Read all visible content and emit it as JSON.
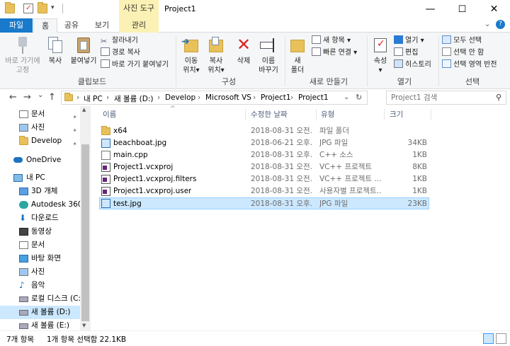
{
  "window": {
    "title": "Project1",
    "context_tab_title": "사진 도구",
    "minimize": "—",
    "maximize": "☐",
    "close": "✕"
  },
  "ribbon_tabs": {
    "file": "파일",
    "home": "홈",
    "share": "공유",
    "view": "보기",
    "manage": "관리"
  },
  "clipboard": {
    "pin_quick": "바로 가기에 고정",
    "pin_l1": "바로 가기에",
    "pin_l2": "고정",
    "copy": "복사",
    "paste": "붙여넣기",
    "cut": "잘라내기",
    "copy_path": "경로 복사",
    "paste_shortcut": "바로 가기 붙여넣기",
    "label": "클립보드"
  },
  "organize": {
    "move_l1": "이동",
    "move_l2": "위치▾",
    "copy_l1": "복사",
    "copy_l2": "위치▾",
    "delete": "삭제",
    "rename_l1": "이름",
    "rename_l2": "바꾸기",
    "label": "구성"
  },
  "new_group": {
    "folder_l1": "새",
    "folder_l2": "폴더",
    "new_item": "새 항목 ▾",
    "easy_access": "빠른 연결 ▾",
    "label": "새로 만들기"
  },
  "open_group": {
    "properties": "속성",
    "open": "열기 ▾",
    "edit": "편집",
    "history": "히스토리",
    "label": "열기"
  },
  "select_group": {
    "select_all": "모두 선택",
    "select_none": "선택 안 함",
    "invert": "선택 영역 반전",
    "label": "선택"
  },
  "address": {
    "back": "←",
    "forward": "→",
    "recent": "⌄",
    "up": "↑",
    "crumbs": [
      "내 PC",
      "새 볼륨 (D:)",
      "Develop",
      "Microsoft VS",
      "Project1",
      "Project1"
    ],
    "sep": "›",
    "refresh": "↻",
    "search_placeholder": "Project1 검색"
  },
  "navpane": {
    "items": [
      {
        "label": "문서",
        "pinned": true
      },
      {
        "label": "사진",
        "pinned": true
      },
      {
        "label": "Develop",
        "pinned": true
      },
      {
        "label": "OneDrive"
      },
      {
        "label": "내 PC"
      },
      {
        "label": "3D 개체"
      },
      {
        "label": "Autodesk 360"
      },
      {
        "label": "다운로드"
      },
      {
        "label": "동영상"
      },
      {
        "label": "문서"
      },
      {
        "label": "바탕 화면"
      },
      {
        "label": "사진"
      },
      {
        "label": "음악"
      },
      {
        "label": "로컬 디스크 (C:)"
      },
      {
        "label": "새 볼륨 (D:)"
      },
      {
        "label": "새 볼륨 (E:)"
      }
    ],
    "pin_glyph": "📌"
  },
  "columns": {
    "name": "이름",
    "date": "수정한 날짜",
    "type": "유형",
    "size": "크기",
    "sort_glyph": "^"
  },
  "files": [
    {
      "name": "x64",
      "date": "2018-08-31 오전...",
      "type": "파일 폴더",
      "size": "",
      "kind": "folder"
    },
    {
      "name": "beachboat.jpg",
      "date": "2018-06-21 오후...",
      "type": "JPG 파일",
      "size": "34KB",
      "kind": "image"
    },
    {
      "name": "main.cpp",
      "date": "2018-08-31 오후...",
      "type": "C++ 소스",
      "size": "1KB",
      "kind": "cpp"
    },
    {
      "name": "Project1.vcxproj",
      "date": "2018-08-31 오전...",
      "type": "VC++ 프로젝트",
      "size": "8KB",
      "kind": "vcx"
    },
    {
      "name": "Project1.vcxproj.filters",
      "date": "2018-08-31 오전...",
      "type": "VC++ 프로젝트 ...",
      "size": "1KB",
      "kind": "vcx"
    },
    {
      "name": "Project1.vcxproj.user",
      "date": "2018-08-31 오전...",
      "type": "사용자별 프로젝트...",
      "size": "1KB",
      "kind": "vcx"
    },
    {
      "name": "test.jpg",
      "date": "2018-08-31 오후...",
      "type": "JPG 파일",
      "size": "23KB",
      "kind": "image",
      "selected": true
    }
  ],
  "status": {
    "count": "7개 항목",
    "selected": "1개 항목 선택함 22.1KB"
  },
  "colors": {
    "accent": "#1979ca",
    "selection": "#cce8ff",
    "selection_border": "#99d1ff",
    "context_tab": "#fcf1b4",
    "folder": "#e8c15a"
  }
}
